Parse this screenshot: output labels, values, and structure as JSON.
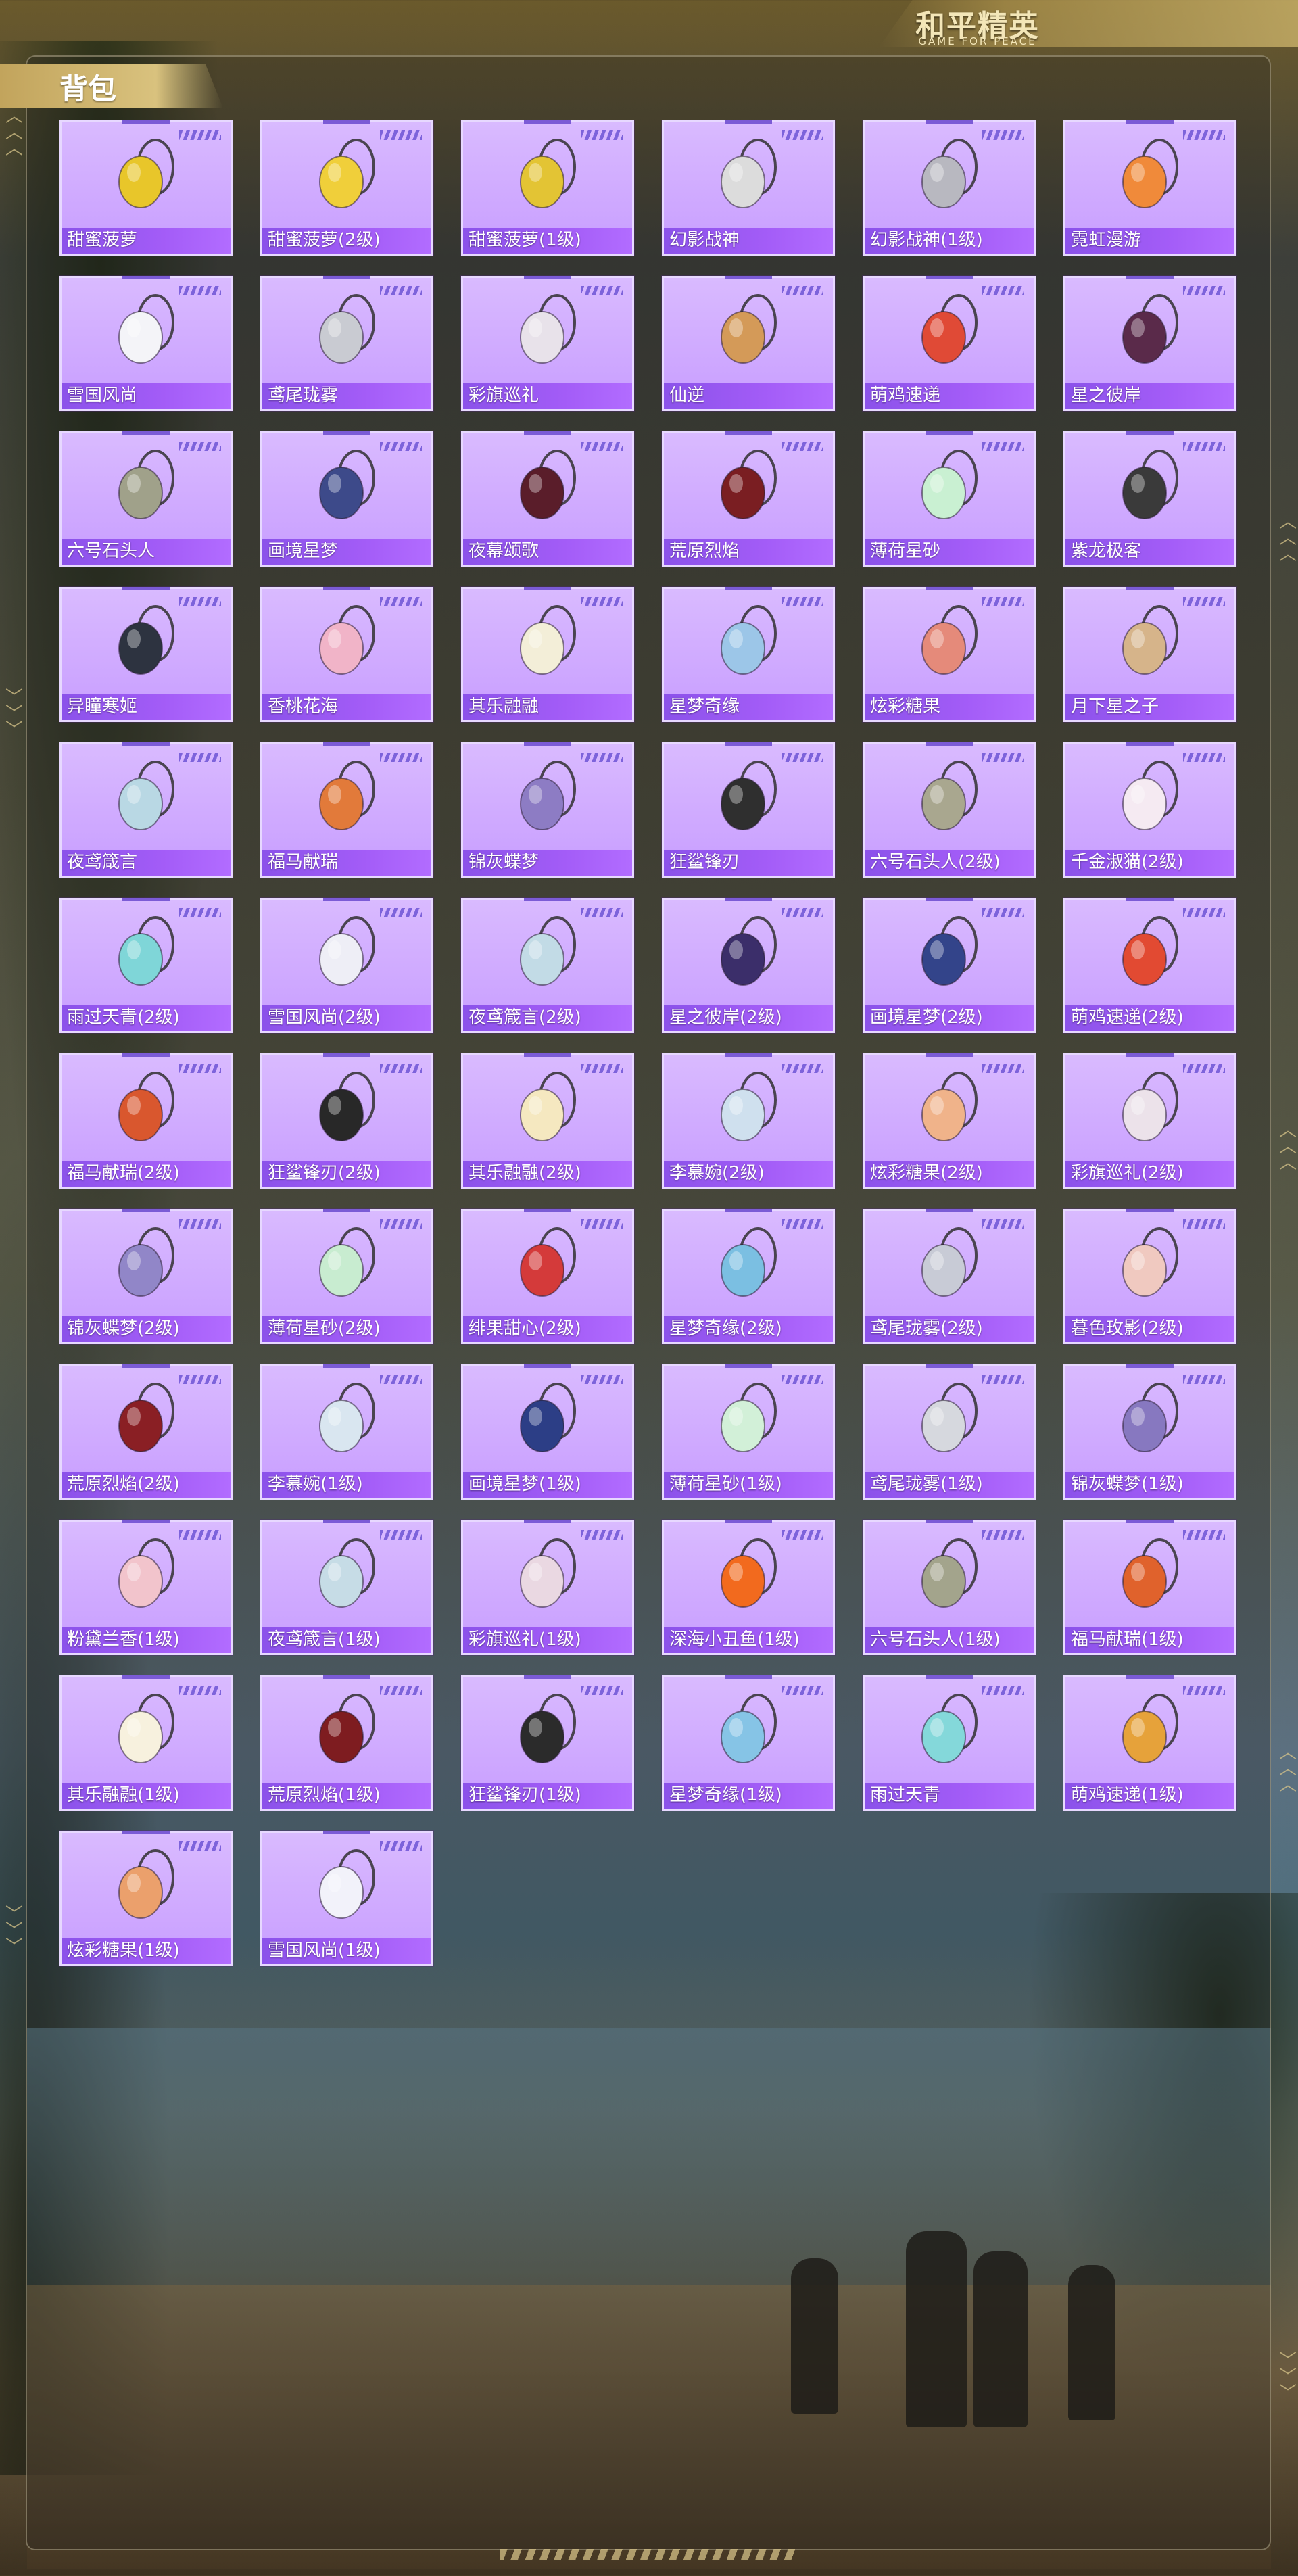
{
  "brand": {
    "title": "和平精英",
    "subtitle": "GAME FOR PEACE"
  },
  "section": {
    "title": "背包"
  },
  "items": [
    {
      "label": "甜蜜菠萝",
      "icon": "pineapple-backpack-icon",
      "color": "#e8c62a"
    },
    {
      "label": "甜蜜菠萝(2级)",
      "icon": "pineapple-backpack-icon",
      "color": "#f0cf3a"
    },
    {
      "label": "甜蜜菠萝(1级)",
      "icon": "pineapple-backpack-icon",
      "color": "#e3c434"
    },
    {
      "label": "幻影战神",
      "icon": "tech-backpack-icon",
      "color": "#dcdcdc"
    },
    {
      "label": "幻影战神(1级)",
      "icon": "tech-backpack-icon",
      "color": "#b8b8c0"
    },
    {
      "label": "霓虹漫游",
      "icon": "neon-backpack-icon",
      "color": "#f08a3a"
    },
    {
      "label": "雪国风尚",
      "icon": "snowman-backpack-icon",
      "color": "#f4f4f8"
    },
    {
      "label": "鸢尾珑雾",
      "icon": "mist-pendant-icon",
      "color": "#c9cbd2"
    },
    {
      "label": "彩旗巡礼",
      "icon": "flag-pendant-icon",
      "color": "#e8e2ea"
    },
    {
      "label": "仙逆",
      "icon": "emblem-pendant-icon",
      "color": "#d49a58"
    },
    {
      "label": "萌鸡速递",
      "icon": "chick-pendant-icon",
      "color": "#e04a36"
    },
    {
      "label": "星之彼岸",
      "icon": "star-backpack-icon",
      "color": "#5a2a4a"
    },
    {
      "label": "六号石头人",
      "icon": "rock-pendant-icon",
      "color": "#a0a18a"
    },
    {
      "label": "画境星梦",
      "icon": "book-pendant-icon",
      "color": "#3d4a8a"
    },
    {
      "label": "夜幕颂歌",
      "icon": "night-backpack-icon",
      "color": "#5a1d2a"
    },
    {
      "label": "荒原烈焰",
      "icon": "flame-backpack-icon",
      "color": "#7a1e22"
    },
    {
      "label": "薄荷星砂",
      "icon": "mint-pendant-icon",
      "color": "#c9f0d2"
    },
    {
      "label": "紫龙极客",
      "icon": "dragon-backpack-icon",
      "color": "#3a3a3a"
    },
    {
      "label": "异瞳寒姬",
      "icon": "ice-pendant-icon",
      "color": "#2d3340"
    },
    {
      "label": "香桃花海",
      "icon": "peach-pendant-icon",
      "color": "#f1b4c8"
    },
    {
      "label": "其乐融融",
      "icon": "bunny-pendant-icon",
      "color": "#f3eed8"
    },
    {
      "label": "星梦奇缘",
      "icon": "swan-pendant-icon",
      "color": "#9cc6e8"
    },
    {
      "label": "炫彩糖果",
      "icon": "candy-pendant-icon",
      "color": "#e58a7a"
    },
    {
      "label": "月下星之子",
      "icon": "moon-pendant-icon",
      "color": "#d6b48a"
    },
    {
      "label": "夜鸢箴言",
      "icon": "crystal-pendant-icon",
      "color": "#b9d8e4"
    },
    {
      "label": "福马献瑞",
      "icon": "horse-pendant-icon",
      "color": "#e27a3a"
    },
    {
      "label": "锦灰蝶梦",
      "icon": "butterfly-pendant-icon",
      "color": "#8d7cc4"
    },
    {
      "label": "狂鲨锋刃",
      "icon": "shark-pendant-icon",
      "color": "#2f2f2f"
    },
    {
      "label": "六号石头人(2级)",
      "icon": "rock-pendant-icon",
      "color": "#a9a78f"
    },
    {
      "label": "千金淑猫(2级)",
      "icon": "cat-pendant-icon",
      "color": "#f5eaf2"
    },
    {
      "label": "雨过天青(2级)",
      "icon": "fish-pendant-icon",
      "color": "#7fd6d8"
    },
    {
      "label": "雪国风尚(2级)",
      "icon": "snowman-backpack-icon",
      "color": "#eeeef6"
    },
    {
      "label": "夜鸢箴言(2级)",
      "icon": "crystal-pendant-icon",
      "color": "#c2dbe6"
    },
    {
      "label": "星之彼岸(2级)",
      "icon": "star-backpack-icon",
      "color": "#3b2e6a"
    },
    {
      "label": "画境星梦(2级)",
      "icon": "book-pendant-icon",
      "color": "#33448a"
    },
    {
      "label": "萌鸡速递(2级)",
      "icon": "chick-pendant-icon",
      "color": "#e24a32"
    },
    {
      "label": "福马献瑞(2级)",
      "icon": "horse-pendant-icon",
      "color": "#d9572e"
    },
    {
      "label": "狂鲨锋刃(2级)",
      "icon": "shark-pendant-icon",
      "color": "#282828"
    },
    {
      "label": "其乐融融(2级)",
      "icon": "bunny-pendant-icon",
      "color": "#f5e8c0"
    },
    {
      "label": "李慕婉(2级)",
      "icon": "spirit-pendant-icon",
      "color": "#cfe0ee"
    },
    {
      "label": "炫彩糖果(2级)",
      "icon": "candy-pendant-icon",
      "color": "#f0b38a"
    },
    {
      "label": "彩旗巡礼(2级)",
      "icon": "flag-pendant-icon",
      "color": "#ece2ea"
    },
    {
      "label": "锦灰蝶梦(2级)",
      "icon": "butterfly-pendant-icon",
      "color": "#9186c8"
    },
    {
      "label": "薄荷星砂(2级)",
      "icon": "mint-pendant-icon",
      "color": "#c8ecd0"
    },
    {
      "label": "绯果甜心(2级)",
      "icon": "cherry-pendant-icon",
      "color": "#d43a3a"
    },
    {
      "label": "星梦奇缘(2级)",
      "icon": "swan-pendant-icon",
      "color": "#7bbfe2"
    },
    {
      "label": "鸢尾珑雾(2级)",
      "icon": "mist-pendant-icon",
      "color": "#c8cbd6"
    },
    {
      "label": "暮色玫影(2级)",
      "icon": "rose-pendant-icon",
      "color": "#f0c9c0"
    },
    {
      "label": "荒原烈焰(2级)",
      "icon": "flame-pendant-icon",
      "color": "#8a1f24"
    },
    {
      "label": "李慕婉(1级)",
      "icon": "spirit-pendant-icon",
      "color": "#d9e6f0"
    },
    {
      "label": "画境星梦(1级)",
      "icon": "book-pendant-icon",
      "color": "#2c3e86"
    },
    {
      "label": "薄荷星砂(1级)",
      "icon": "mint-pendant-icon",
      "color": "#d2f0d8"
    },
    {
      "label": "鸢尾珑雾(1级)",
      "icon": "mist-pendant-icon",
      "color": "#d6d8de"
    },
    {
      "label": "锦灰蝶梦(1级)",
      "icon": "butterfly-pendant-icon",
      "color": "#8778c0"
    },
    {
      "label": "粉黛兰香(1级)",
      "icon": "orchid-pendant-icon",
      "color": "#f2c4cc"
    },
    {
      "label": "夜鸢箴言(1级)",
      "icon": "crystal-pendant-icon",
      "color": "#c6dce6"
    },
    {
      "label": "彩旗巡礼(1级)",
      "icon": "flag-pendant-icon",
      "color": "#ead8e2"
    },
    {
      "label": "深海小丑鱼(1级)",
      "icon": "clownfish-backpack-icon",
      "color": "#f26a1e"
    },
    {
      "label": "六号石头人(1级)",
      "icon": "rock-pendant-icon",
      "color": "#a3a48c"
    },
    {
      "label": "福马献瑞(1级)",
      "icon": "horse-pendant-icon",
      "color": "#e0622c"
    },
    {
      "label": "其乐融融(1级)",
      "icon": "bunny-pendant-icon",
      "color": "#f7f1de"
    },
    {
      "label": "荒原烈焰(1级)",
      "icon": "flame-pendant-icon",
      "color": "#7e1c20"
    },
    {
      "label": "狂鲨锋刃(1级)",
      "icon": "shark-pendant-icon",
      "color": "#2b2b2b"
    },
    {
      "label": "星梦奇缘(1级)",
      "icon": "swan-pendant-icon",
      "color": "#86c4e6"
    },
    {
      "label": "雨过天青",
      "icon": "fish-pendant-icon",
      "color": "#84d8da"
    },
    {
      "label": "萌鸡速递(1级)",
      "icon": "chick-pendant-icon",
      "color": "#e6a23a"
    },
    {
      "label": "炫彩糖果(1级)",
      "icon": "candy-pendant-icon",
      "color": "#eba06c"
    },
    {
      "label": "雪国风尚(1级)",
      "icon": "snowman-backpack-icon",
      "color": "#f2f2fa"
    }
  ]
}
